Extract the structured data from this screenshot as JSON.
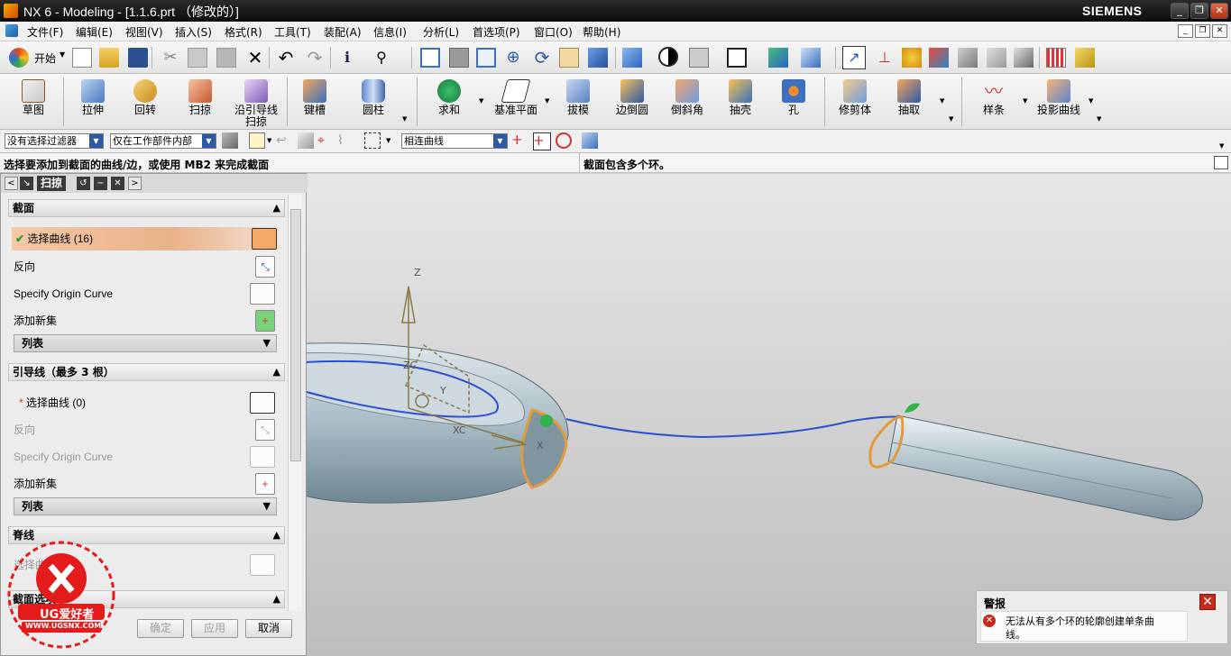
{
  "window": {
    "title": "NX 6 - Modeling - [1.1.6.prt （修改的）]",
    "brand": "SIEMENS"
  },
  "menubar": {
    "items": [
      "文件(F)",
      "编辑(E)",
      "视图(V)",
      "插入(S)",
      "格式(R)",
      "工具(T)",
      "装配(A)",
      "信息(I)",
      "分析(L)",
      "首选项(P)",
      "窗口(O)",
      "帮助(H)"
    ]
  },
  "toolbar1": {
    "start_label": "开始"
  },
  "feature_toolbar": {
    "buttons": [
      "草图",
      "拉伸",
      "回转",
      "扫掠",
      "沿引导线扫掠",
      "键槽",
      "圆柱",
      "求和",
      "基准平面",
      "拔模",
      "边倒圆",
      "倒斜角",
      "抽壳",
      "孔",
      "修剪体",
      "抽取",
      "样条",
      "投影曲线"
    ]
  },
  "selection_bar": {
    "filter": "没有选择过滤器",
    "scope": "仅在工作部件内部",
    "curve_rule": "相连曲线"
  },
  "status": {
    "prompt": "选择要添加到截面的曲线/边，或使用 MB2 来完成截面",
    "message": "截面包含多个环。"
  },
  "dialog": {
    "tab_title": "扫掠",
    "sections": {
      "title": "截面",
      "select_curve": "选择曲线 (16)",
      "reverse": "反向",
      "origin_curve": "Specify Origin Curve",
      "add_set": "添加新集",
      "list": "列表"
    },
    "guides": {
      "title": "引导线（最多 3 根）",
      "select_curve": "选择曲线 (0)",
      "reverse": "反向",
      "origin_curve": "Specify Origin Curve",
      "add_set": "添加新集",
      "list": "列表"
    },
    "spine": {
      "title": "脊线",
      "select_curve": "选择曲线"
    },
    "section_options": {
      "title": "截面选项"
    },
    "buttons": {
      "ok": "确定",
      "apply": "应用",
      "cancel": "取消"
    }
  },
  "viewport": {
    "axis_labels": [
      "Z",
      "ZC",
      "Y",
      "XC",
      "X"
    ]
  },
  "warning": {
    "title": "警报",
    "message_line1": "无法从有多个环的轮廓创建单条曲",
    "message_line2": "线。"
  },
  "watermark": {
    "text": "UG爱好者",
    "url": "WWW.UGSNX.COM"
  },
  "colors": {
    "title_bg": "#111111",
    "dialog_selected": "#f4a86a",
    "curve": "#2b4fd0",
    "section_outline": "#e39a3a",
    "warning_icon": "#c62a1b"
  }
}
